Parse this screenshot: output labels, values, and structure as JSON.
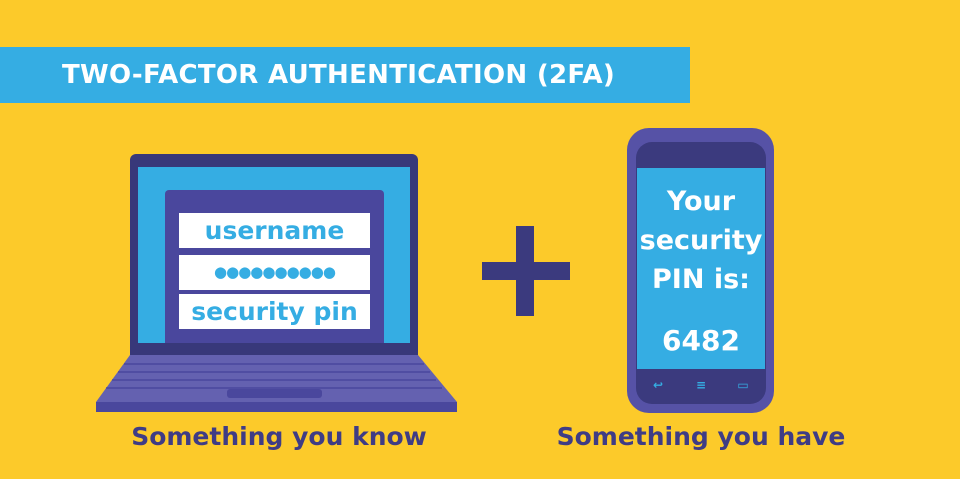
{
  "banner": {
    "title": "TWO-FACTOR AUTHENTICATION (2FA)"
  },
  "laptop": {
    "fields": [
      "username",
      "●●●●●●●●●●",
      "security pin"
    ],
    "caption": "Something you know"
  },
  "operator": "+",
  "phone": {
    "lines": [
      "Your",
      "security",
      "PIN is:"
    ],
    "pin": "6482",
    "nav_icons": [
      "back-icon",
      "menu-icon",
      "recent-apps-icon"
    ],
    "caption": "Something you have"
  },
  "colors": {
    "background": "#FCCA2A",
    "blue": "#35ADE3",
    "purple": "#3B3A7E"
  }
}
